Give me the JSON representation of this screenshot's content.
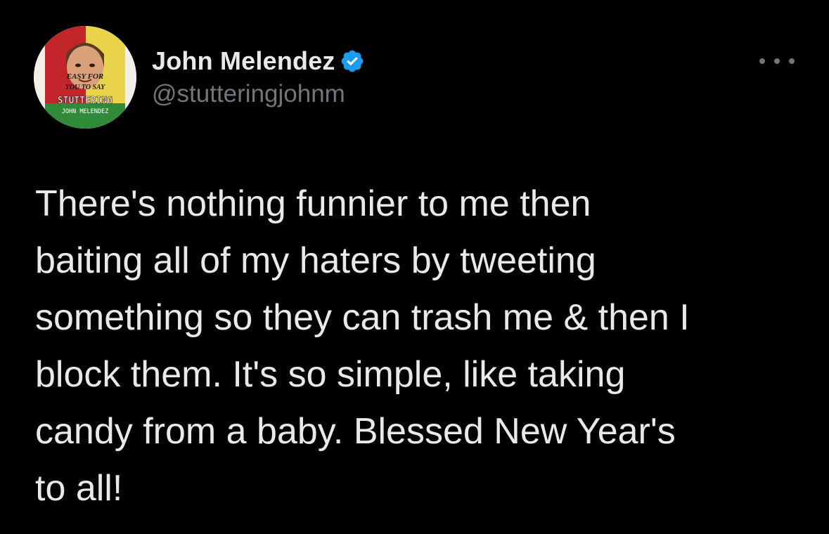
{
  "tweet": {
    "author": {
      "display_name": "John Melendez",
      "handle": "@stutteringjohnm",
      "verified_icon": "verified-badge-icon",
      "avatar": {
        "line1": "EASY FOR",
        "line2": "YOU TO SAY",
        "line3": "STUTTERING",
        "line4": "JOHN MELENDEZ"
      }
    },
    "more_icon": "more-options-icon",
    "text_lines": [
      "There's nothing funnier to me then",
      "baiting all of my haters by tweeting",
      "something so they can trash me & then I",
      "block them. It's so simple, like taking",
      "candy from a baby. Blessed New Year's",
      "to all!"
    ]
  },
  "colors": {
    "background": "#000000",
    "primary_text": "#e7e9ea",
    "secondary_text": "#71767b",
    "verified_blue": "#1d9bf0"
  }
}
